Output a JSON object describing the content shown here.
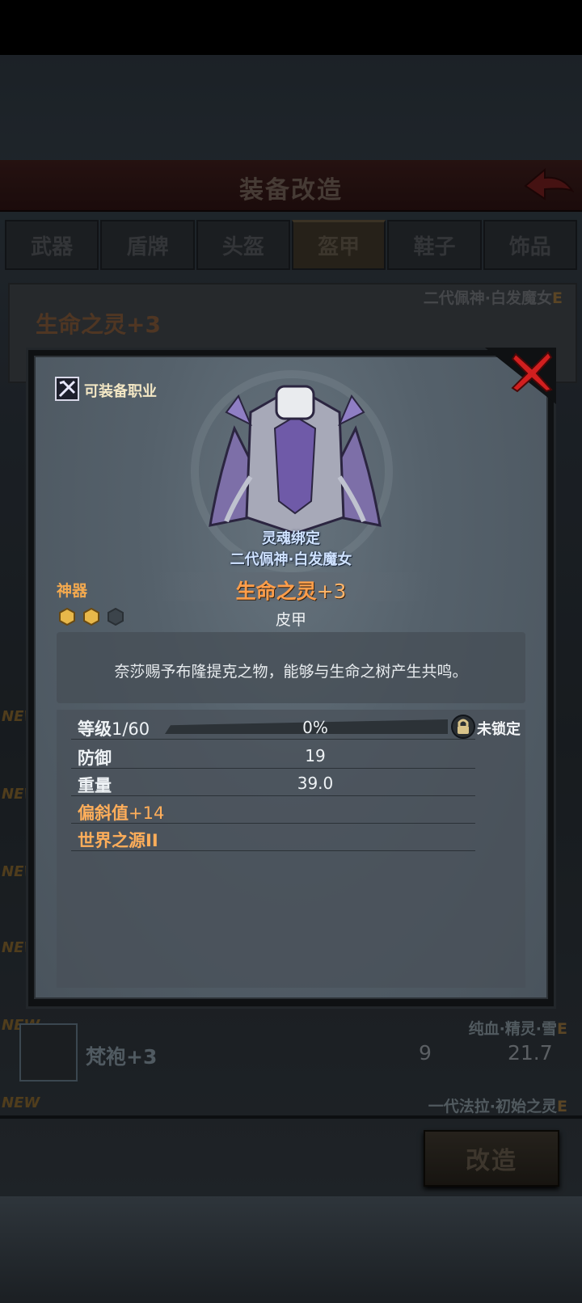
{
  "header": {
    "title": "装备改造"
  },
  "tabs": [
    {
      "label": "武器"
    },
    {
      "label": "盾牌"
    },
    {
      "label": "头盔"
    },
    {
      "label": "盔甲"
    },
    {
      "label": "鞋子"
    },
    {
      "label": "饰品"
    }
  ],
  "background_card": {
    "owner": "二代佩神·白发魔女",
    "owner_suffix": "E",
    "item_name": "生命之灵+3"
  },
  "background_rows": [
    {
      "new": "NEW",
      "owner": "纯血·精灵·雪",
      "owner_suffix": "E",
      "name": "梵袍+3",
      "defense": "9",
      "weight": "21.7"
    },
    {
      "new": "NEW",
      "owner": "一代法拉·初始之灵",
      "owner_suffix": "E"
    }
  ],
  "side_new_tags": [
    "NEW",
    "NEW",
    "NEW",
    "NEW"
  ],
  "modify_button": "改造",
  "dialog": {
    "class_label": "可装备职业",
    "soul_bound": "灵魂绑定",
    "owner": "二代佩神·白发魔女",
    "rarity": "神器",
    "item_name": "生命之灵",
    "item_plus": "+3",
    "item_type": "皮甲",
    "description": "奈莎赐予布隆提克之物，能够与生命之树产生共鸣。",
    "gems": [
      {
        "state": "filled",
        "color": "#e8b84a"
      },
      {
        "state": "filled",
        "color": "#e8b84a"
      },
      {
        "state": "empty",
        "color": "#3c444b"
      }
    ],
    "level": {
      "label": "等级",
      "value": "1/60",
      "progress_text": "0%",
      "progress": 0
    },
    "lock_label": "未锁定",
    "stats": [
      {
        "label": "防御",
        "value": "19"
      },
      {
        "label": "重量",
        "value": "39.0"
      }
    ],
    "bonus": {
      "label": "偏斜值",
      "value": "+14"
    },
    "enchant": "世界之源II",
    "colors": {
      "rarity": "#f3a94f",
      "title": "#ff9e4a",
      "soul_bound": "#cfe2ff"
    },
    "icons": [
      "class-icon",
      "close-icon",
      "lock-icon",
      "gem-icon"
    ]
  }
}
